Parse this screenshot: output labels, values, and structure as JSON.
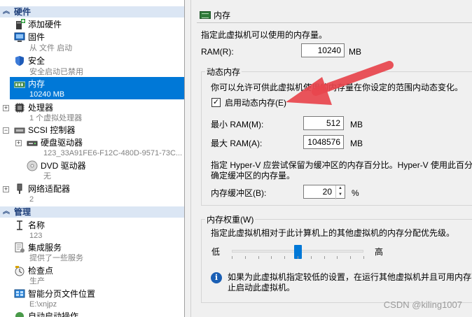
{
  "left_panel": {
    "hardware_header": "硬件",
    "management_header": "管理",
    "items": {
      "add_hardware": "添加硬件",
      "firmware": "固件",
      "firmware_sub": "从 文件 启动",
      "security": "安全",
      "security_sub": "安全启动已禁用",
      "memory": "内存",
      "memory_sub": "10240 MB",
      "processor": "处理器",
      "processor_sub": "1 个虚拟处理器",
      "scsi": "SCSI 控制器",
      "hdd": "硬盘驱动器",
      "hdd_sub": "123_33A91FE6-F12C-480D-9571-73C...",
      "dvd": "DVD 驱动器",
      "dvd_sub": "无",
      "network": "网络适配器",
      "network_sub": "2",
      "name": "名称",
      "name_sub": "123",
      "integration": "集成服务",
      "integration_sub": "提供了一些服务",
      "checkpoint": "检查点",
      "checkpoint_sub": "生产",
      "smart_paging": "智能分页文件位置",
      "smart_paging_sub": "E:\\xnjpz",
      "auto_start": "自动启动操作"
    }
  },
  "right_panel": {
    "title": "内存",
    "description": "指定此虚拟机可以使用的内存量。",
    "ram_label": "RAM(R):",
    "ram_value": "10240",
    "ram_unit": "MB",
    "dynamic": {
      "title": "动态内存",
      "description": "你可以允许可供此虚拟机使用的内存量在你设定的范围内动态变化。",
      "enable_label": "启用动态内存(E)",
      "enable_checked": "✓",
      "min_label": "最小 RAM(M):",
      "min_value": "512",
      "min_unit": "MB",
      "max_label": "最大 RAM(A):",
      "max_value": "1048576",
      "max_unit": "MB",
      "buffer_desc_1": "指定 Hyper-V 应尝试保留为缓冲区的内存百分比。Hyper-V 使用此百分比",
      "buffer_desc_2": "确定缓冲区的内存量。",
      "buffer_label": "内存缓冲区(B):",
      "buffer_value": "20",
      "buffer_unit": "%"
    },
    "weight": {
      "title": "内存权重(W)",
      "description": "指定此虚拟机相对于此计算机上的其他虚拟机的内存分配优先级。",
      "low": "低",
      "high": "高",
      "level": 0.5,
      "info_1": "如果为此虚拟机指定较低的设置，在运行其他虚拟机并且可用内存不足",
      "info_2": "止启动此虚拟机。"
    }
  },
  "watermark": "CSDN @kiling1007",
  "colors": {
    "selection": "#0078d7",
    "header_bg": "#dbe6f4",
    "arrow": "#e8454d"
  },
  "icons": {
    "collapse": "chevron-double-up-icon",
    "info": "info-icon"
  }
}
